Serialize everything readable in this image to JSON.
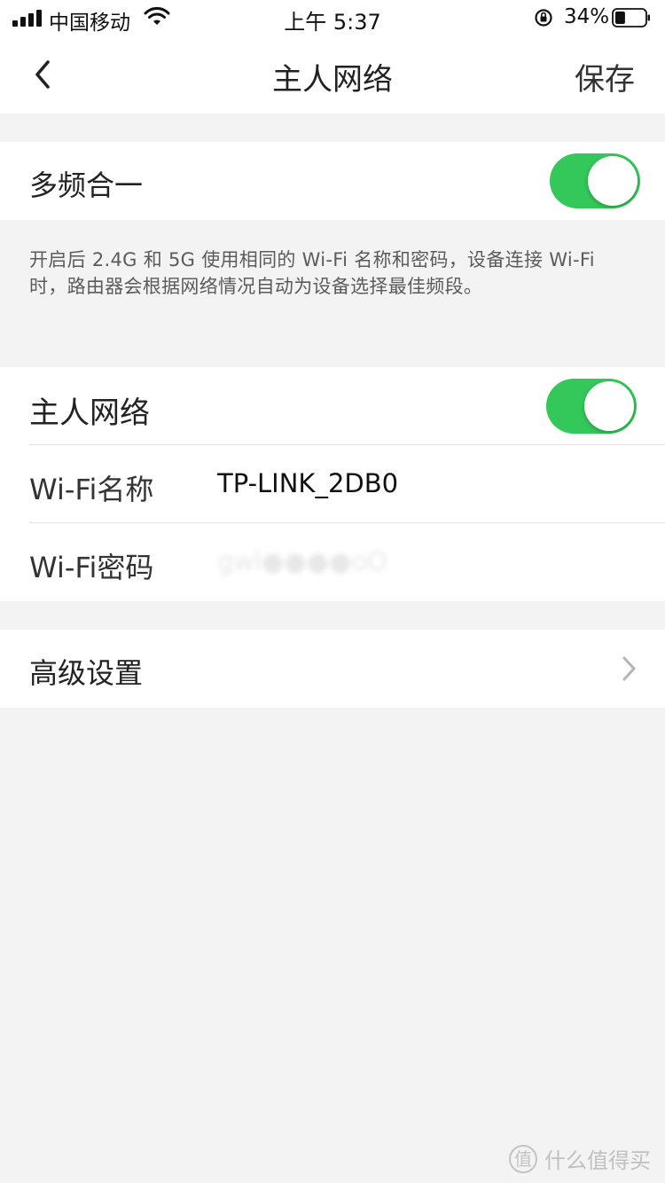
{
  "status_bar": {
    "carrier": "中国移动",
    "time": "上午 5:37",
    "battery_percent": "34%",
    "battery_level": 0.34,
    "icons": [
      "signal-icon",
      "wifi-icon",
      "rotation-lock-icon",
      "battery-icon"
    ]
  },
  "nav": {
    "title": "主人网络",
    "save_label": "保存",
    "back_icon": "chevron-left-icon"
  },
  "dual_band": {
    "label": "多频合一",
    "enabled": true,
    "description": "开启后 2.4G 和 5G 使用相同的 Wi-Fi 名称和密码，设备连接 Wi-Fi 时，路由器会根据网络情况自动为设备选择最佳频段。"
  },
  "host_network": {
    "label": "主人网络",
    "enabled": true,
    "wifi_name_label": "Wi-Fi名称",
    "wifi_name_value": "TP-LINK_2DB0",
    "wifi_password_label": "Wi-Fi密码",
    "wifi_password_value": "gwl●●●●oO"
  },
  "advanced": {
    "label": "高级设置",
    "icon": "chevron-right-icon"
  },
  "watermark": {
    "mark": "值",
    "text": "什么值得买"
  },
  "colors": {
    "toggle_on": "#34c759",
    "background": "#f3f3f4",
    "card": "#ffffff"
  }
}
